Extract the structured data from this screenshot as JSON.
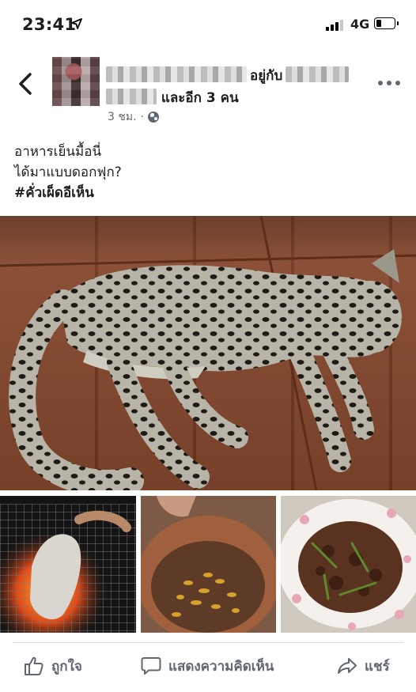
{
  "status_bar": {
    "time": "23:41",
    "network": "4G",
    "battery_level": 0.3,
    "signal_bars_active": 3
  },
  "post": {
    "author_with": "อยู่กับ",
    "author_others": "และอีก 3 คน",
    "timestamp": "3 ชม.",
    "separator": "·",
    "text_lines": [
      "อาหารเย็นมื้อนี่",
      "ได้มาแบบดอกฟุก?"
    ],
    "hashtag": "#คั่วเผ็ดอีเห็น"
  },
  "actions": {
    "like": "ถูกใจ",
    "comment": "แสดงความคิดเห็น",
    "share": "แชร์"
  },
  "icons": {
    "back": "chevron-left-icon",
    "more": "more-dots-icon",
    "privacy": "globe-icon",
    "like": "thumbs-up-icon",
    "comment": "comment-bubble-icon",
    "share": "share-arrow-icon"
  },
  "colors": {
    "secondary_text": "#606770",
    "divider": "#dadde1"
  }
}
